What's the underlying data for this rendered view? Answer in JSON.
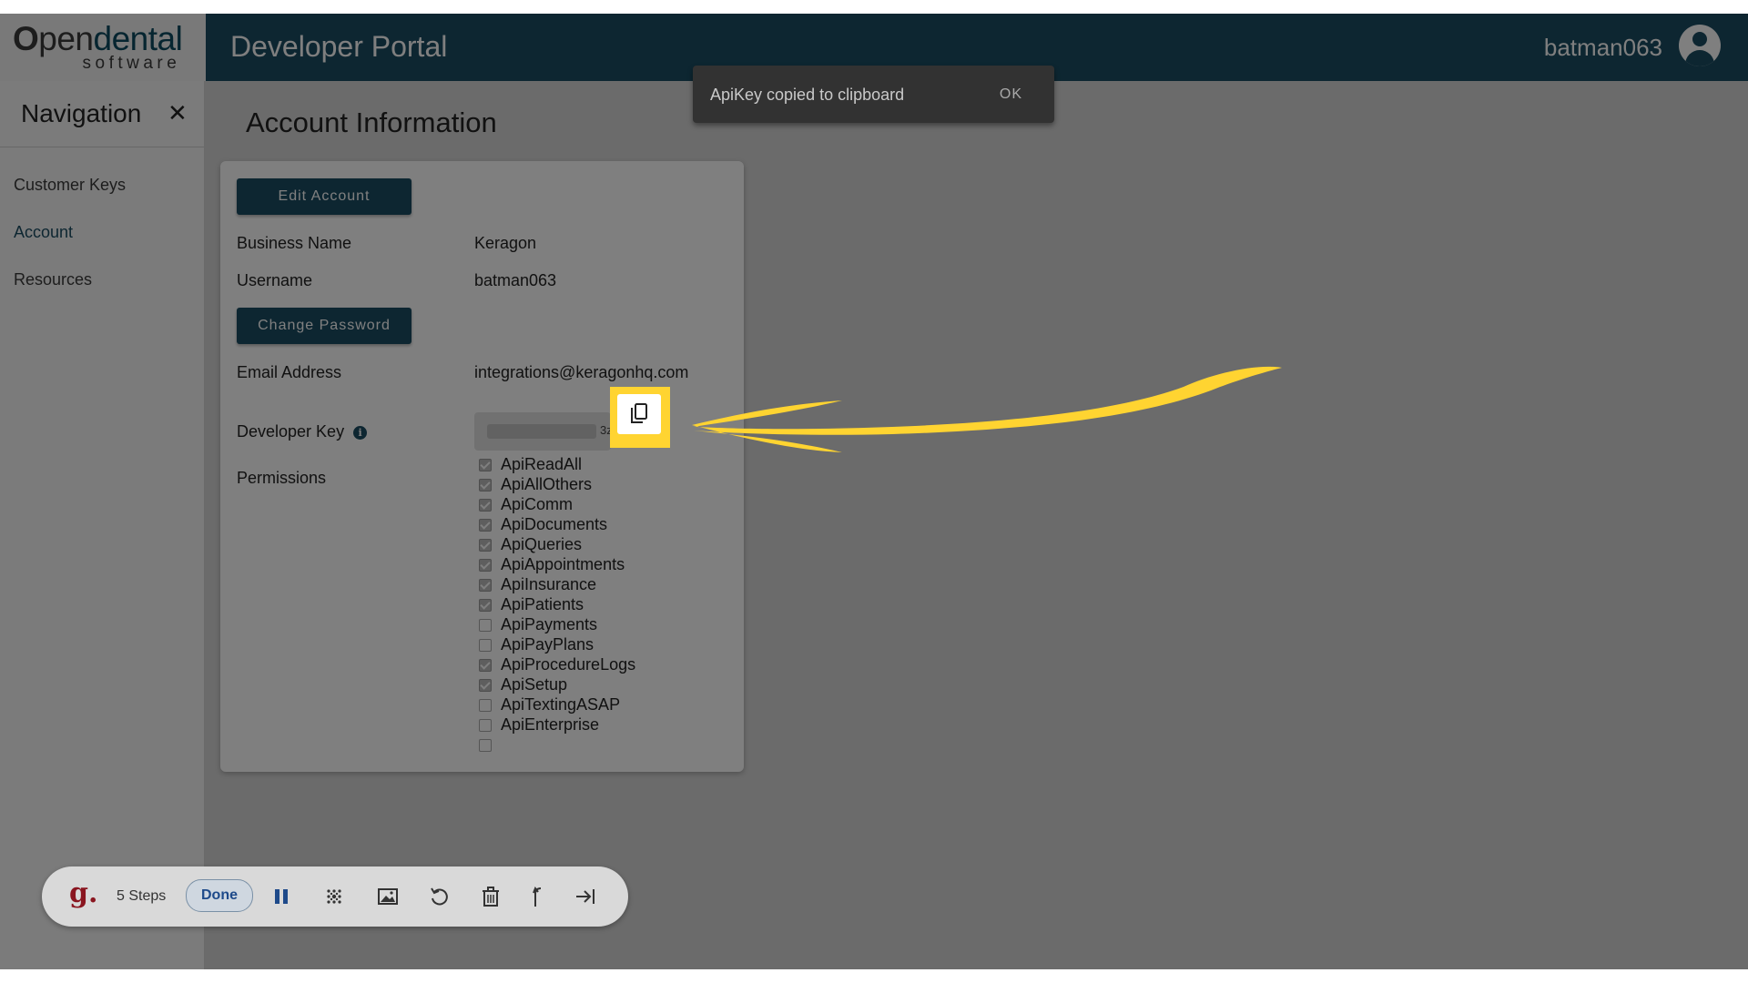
{
  "header": {
    "logo_main_a": "O",
    "logo_main_b": "pen",
    "logo_main_c": "dental",
    "logo_sub": "software",
    "portal_title": "Developer Portal",
    "username": "batman063",
    "brand_color": "#1b4d63"
  },
  "sidebar": {
    "title": "Navigation",
    "close_glyph": "✕",
    "items": [
      {
        "label": "Customer Keys"
      },
      {
        "label": "Account",
        "active": true
      },
      {
        "label": "Resources"
      }
    ]
  },
  "main": {
    "title": "Account Information",
    "edit_account_label": "Edit Account",
    "business_name_label": "Business Name",
    "business_name_value": "Keragon",
    "username_label": "Username",
    "username_value": "batman063",
    "change_password_label": "Change Password",
    "email_label": "Email Address",
    "email_value": "integrations@keragonhq.com",
    "developer_key_label": "Developer Key",
    "developer_key_tail": "3z:",
    "permissions_label": "Permissions",
    "permissions": [
      {
        "name": "ApiReadAll",
        "checked": true
      },
      {
        "name": "ApiAllOthers",
        "checked": true
      },
      {
        "name": "ApiComm",
        "checked": true
      },
      {
        "name": "ApiDocuments",
        "checked": true
      },
      {
        "name": "ApiQueries",
        "checked": true
      },
      {
        "name": "ApiAppointments",
        "checked": true
      },
      {
        "name": "ApiInsurance",
        "checked": true
      },
      {
        "name": "ApiPatients",
        "checked": true
      },
      {
        "name": "ApiPayments",
        "checked": false
      },
      {
        "name": "ApiPayPlans",
        "checked": false
      },
      {
        "name": "ApiProcedureLogs",
        "checked": true
      },
      {
        "name": "ApiSetup",
        "checked": true
      },
      {
        "name": "ApiTextingASAP",
        "checked": false
      },
      {
        "name": "ApiEnterprise",
        "checked": false
      },
      {
        "name": "",
        "checked": false
      }
    ]
  },
  "snackbar": {
    "message": "ApiKey copied to clipboard",
    "action": "OK"
  },
  "annotation": {
    "highlight_color": "#ffd431"
  },
  "recorder": {
    "logo": "g.",
    "steps": "5 Steps",
    "done": "Done"
  }
}
